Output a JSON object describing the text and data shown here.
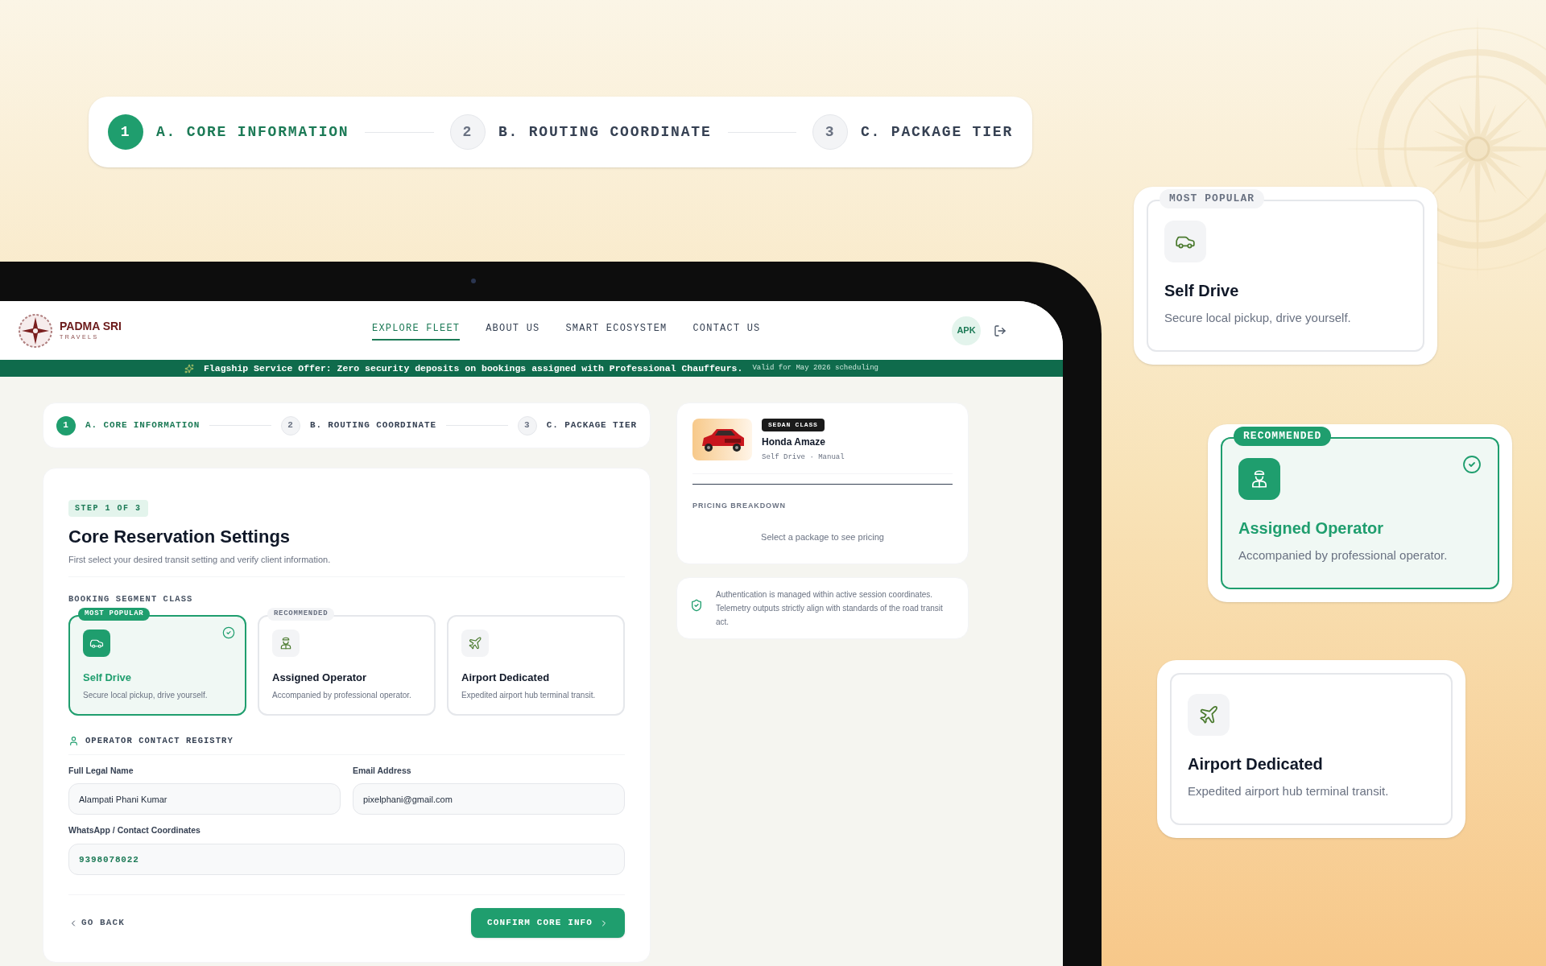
{
  "hero_stepper": {
    "steps": [
      {
        "number": "1",
        "label": "A. CORE INFORMATION",
        "selected": true
      },
      {
        "number": "2",
        "label": "B. ROUTING COORDINATE",
        "selected": false
      },
      {
        "number": "3",
        "label": "C. PACKAGE TIER",
        "selected": false
      }
    ]
  },
  "nav": {
    "brand": "PADMA SRI",
    "brand_sub": "TRAVELS",
    "links": [
      {
        "label": "EXPLORE FLEET",
        "selected": true
      },
      {
        "label": "ABOUT US",
        "selected": false
      },
      {
        "label": "SMART ECOSYSTEM",
        "selected": false
      },
      {
        "label": "CONTACT US",
        "selected": false
      }
    ],
    "avatar": "APK"
  },
  "banner": {
    "text": "Flagship Service Offer: Zero security deposits on bookings assigned with Professional Chauffeurs.",
    "note": "Valid for May 2026 scheduling"
  },
  "app_stepper": {
    "steps": [
      {
        "number": "1",
        "label": "A. CORE INFORMATION",
        "selected": true
      },
      {
        "number": "2",
        "label": "B. ROUTING COORDINATE",
        "selected": false
      },
      {
        "number": "3",
        "label": "C. PACKAGE TIER",
        "selected": false
      }
    ]
  },
  "form": {
    "badge": "STEP 1 OF 3",
    "title": "Core Reservation Settings",
    "subtitle": "First select your desired transit setting and verify client information.",
    "segment_label": "BOOKING SEGMENT CLASS",
    "segments": [
      {
        "kind": "car",
        "tag": "MOST POPULAR",
        "title": "Self Drive",
        "description": "Secure local pickup, drive yourself.",
        "selected": true
      },
      {
        "kind": "operator",
        "tag": "RECOMMENDED",
        "title": "Assigned Operator",
        "description": "Accompanied by professional operator.",
        "selected": false
      },
      {
        "kind": "plane",
        "title": "Airport Dedicated",
        "description": "Expedited airport hub terminal transit.",
        "selected": false
      }
    ],
    "contact_label": "OPERATOR CONTACT REGISTRY",
    "fields": [
      {
        "kind": "text",
        "label": "Full Legal Name",
        "value": "Alampati Phani Kumar"
      },
      {
        "kind": "text",
        "label": "Email Address",
        "value": "pixelphani@gmail.com"
      },
      {
        "kind": "phone",
        "label": "WhatsApp / Contact Coordinates",
        "value": "9398078022"
      }
    ],
    "back": "GO BACK",
    "confirm": "CONFIRM CORE INFO"
  },
  "summary": {
    "class_tag": "SEDAN CLASS",
    "vehicle": "Honda Amaze",
    "meta": "Self Drive · Manual",
    "pricing_label": "PRICING BREAKDOWN",
    "pricing_empty": "Select a package to see pricing"
  },
  "notice": "Authentication is managed within active session coordinates. Telemetry outputs strictly align with standards of the road transit act.",
  "showcase": [
    {
      "kind": "car",
      "tag": "MOST POPULAR",
      "title": "Self Drive",
      "description": "Secure local pickup, drive yourself.",
      "selected": false
    },
    {
      "kind": "operator",
      "tag": "RECOMMENDED",
      "title": "Assigned Operator",
      "description": "Accompanied by professional operator.",
      "selected": true
    },
    {
      "kind": "plane",
      "title": "Airport Dedicated",
      "description": "Expedited airport hub terminal transit.",
      "selected": false
    }
  ]
}
